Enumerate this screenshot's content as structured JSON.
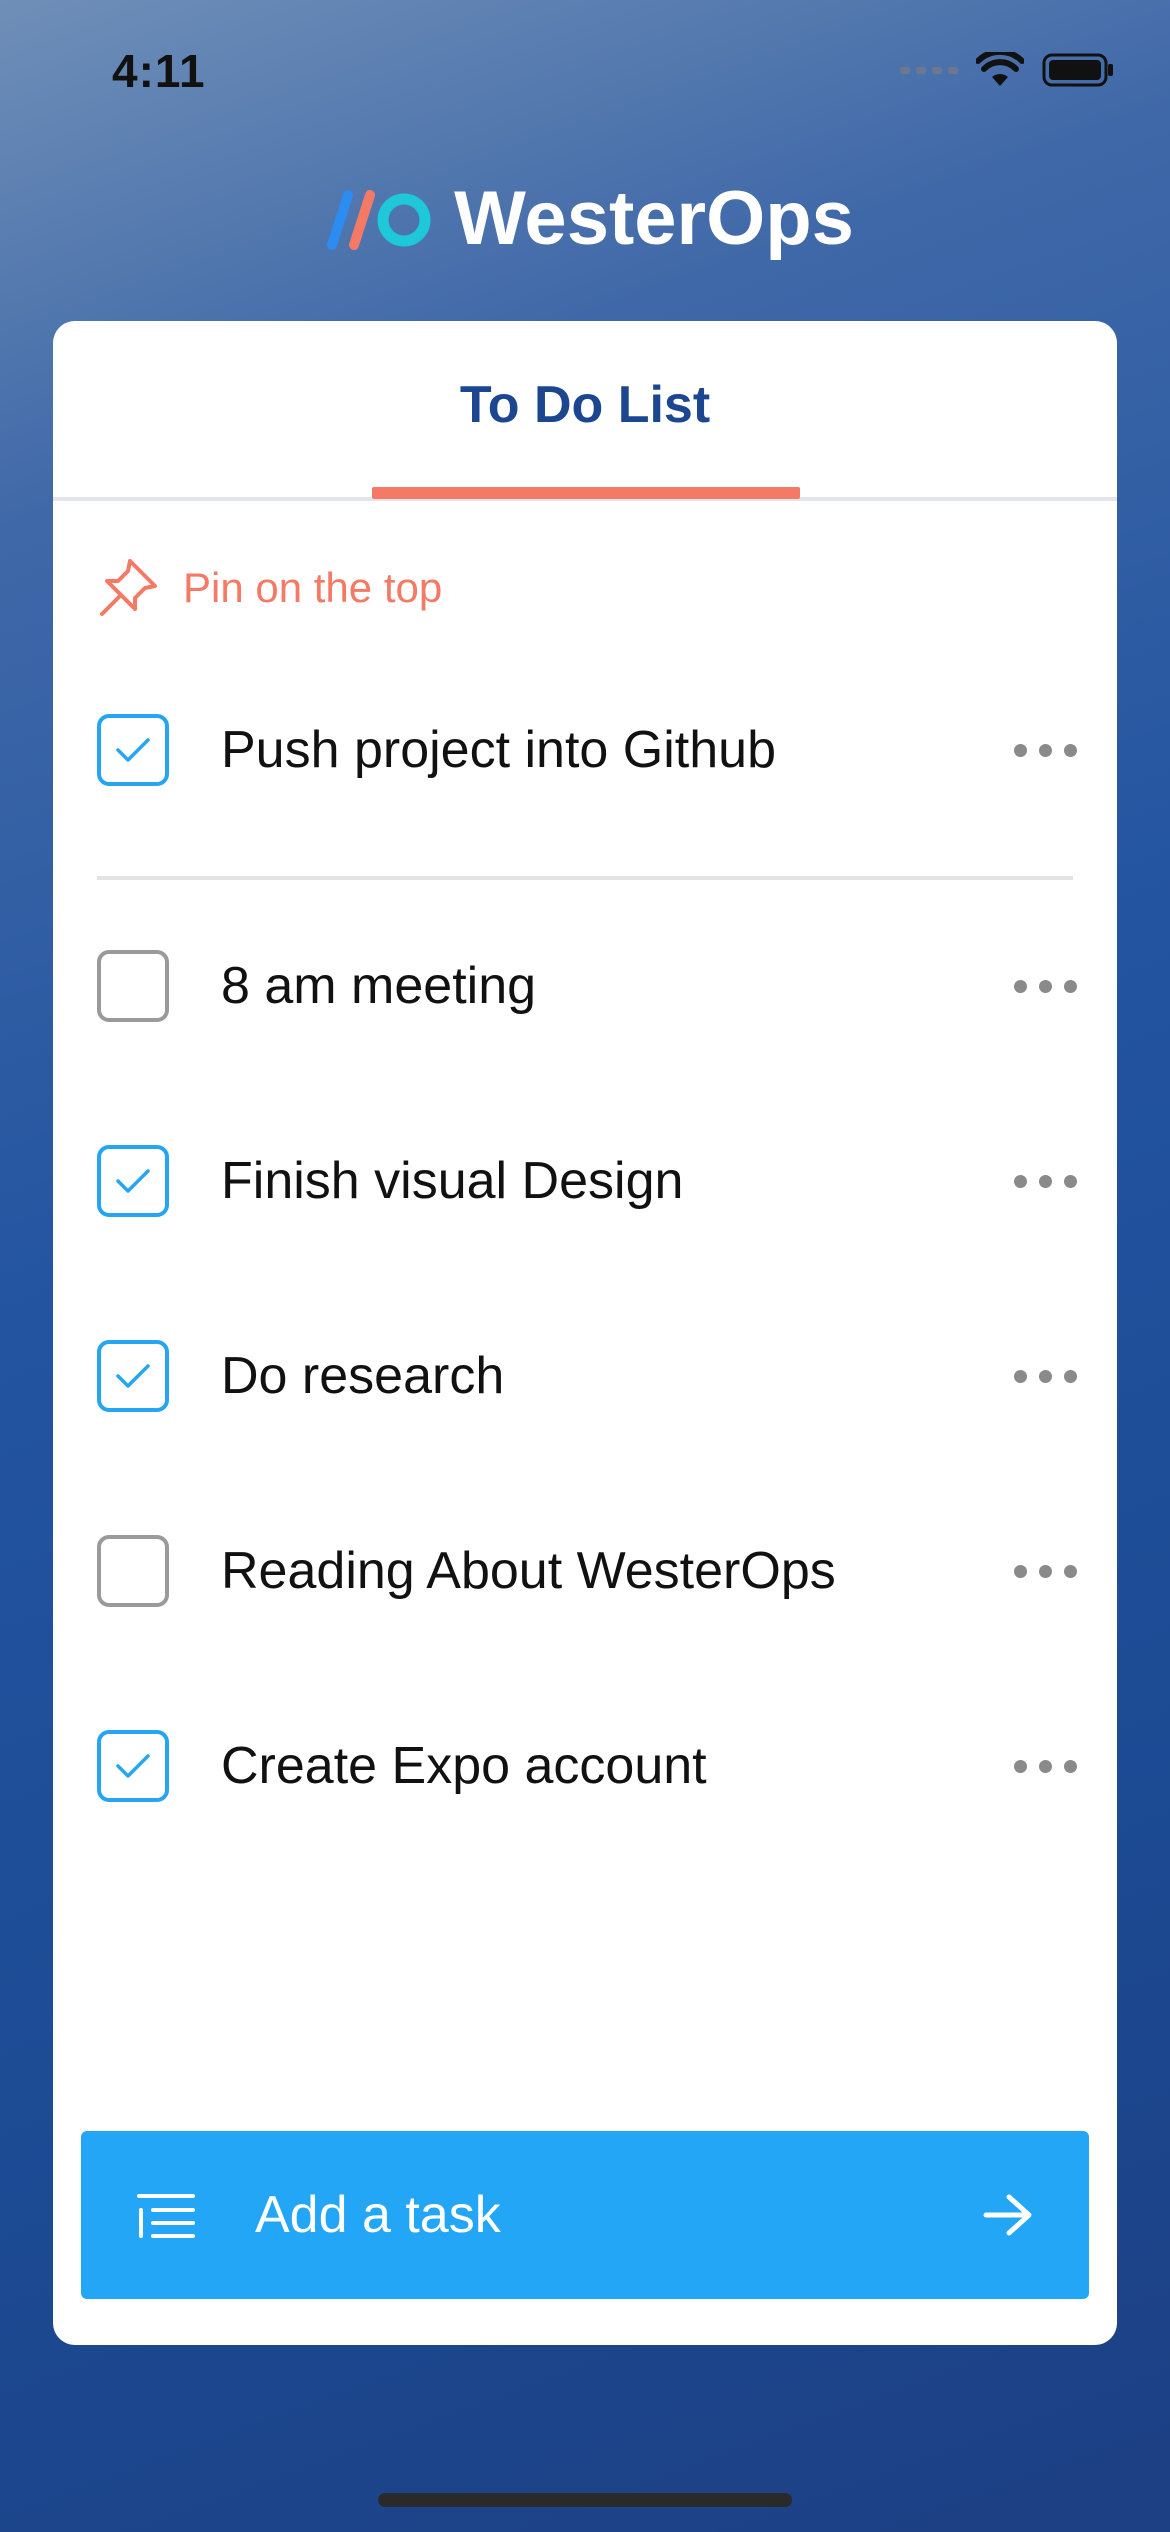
{
  "status_bar": {
    "time": "4:11"
  },
  "brand": {
    "name": "WesterOps"
  },
  "tab": {
    "title": "To Do List"
  },
  "pin": {
    "label": "Pin on the top"
  },
  "pinned_tasks": [
    {
      "label": "Push project into Github",
      "checked": true
    }
  ],
  "tasks": [
    {
      "label": "8 am meeting",
      "checked": false
    },
    {
      "label": "Finish visual Design",
      "checked": true
    },
    {
      "label": "Do research",
      "checked": true
    },
    {
      "label": "Reading About WesterOps",
      "checked": false
    },
    {
      "label": "Create Expo account",
      "checked": true
    }
  ],
  "add_task": {
    "placeholder": "Add a task"
  },
  "colors": {
    "accent": "#22a6f5",
    "brand_blue": "#1d4690",
    "coral": "#f47a65",
    "check_blue": "#26a6f2"
  },
  "icons": {
    "pin": "pin-icon",
    "more": "more-horizontal-icon",
    "list": "list-icon",
    "arrow": "arrow-right-icon",
    "check": "checkmark-icon"
  }
}
